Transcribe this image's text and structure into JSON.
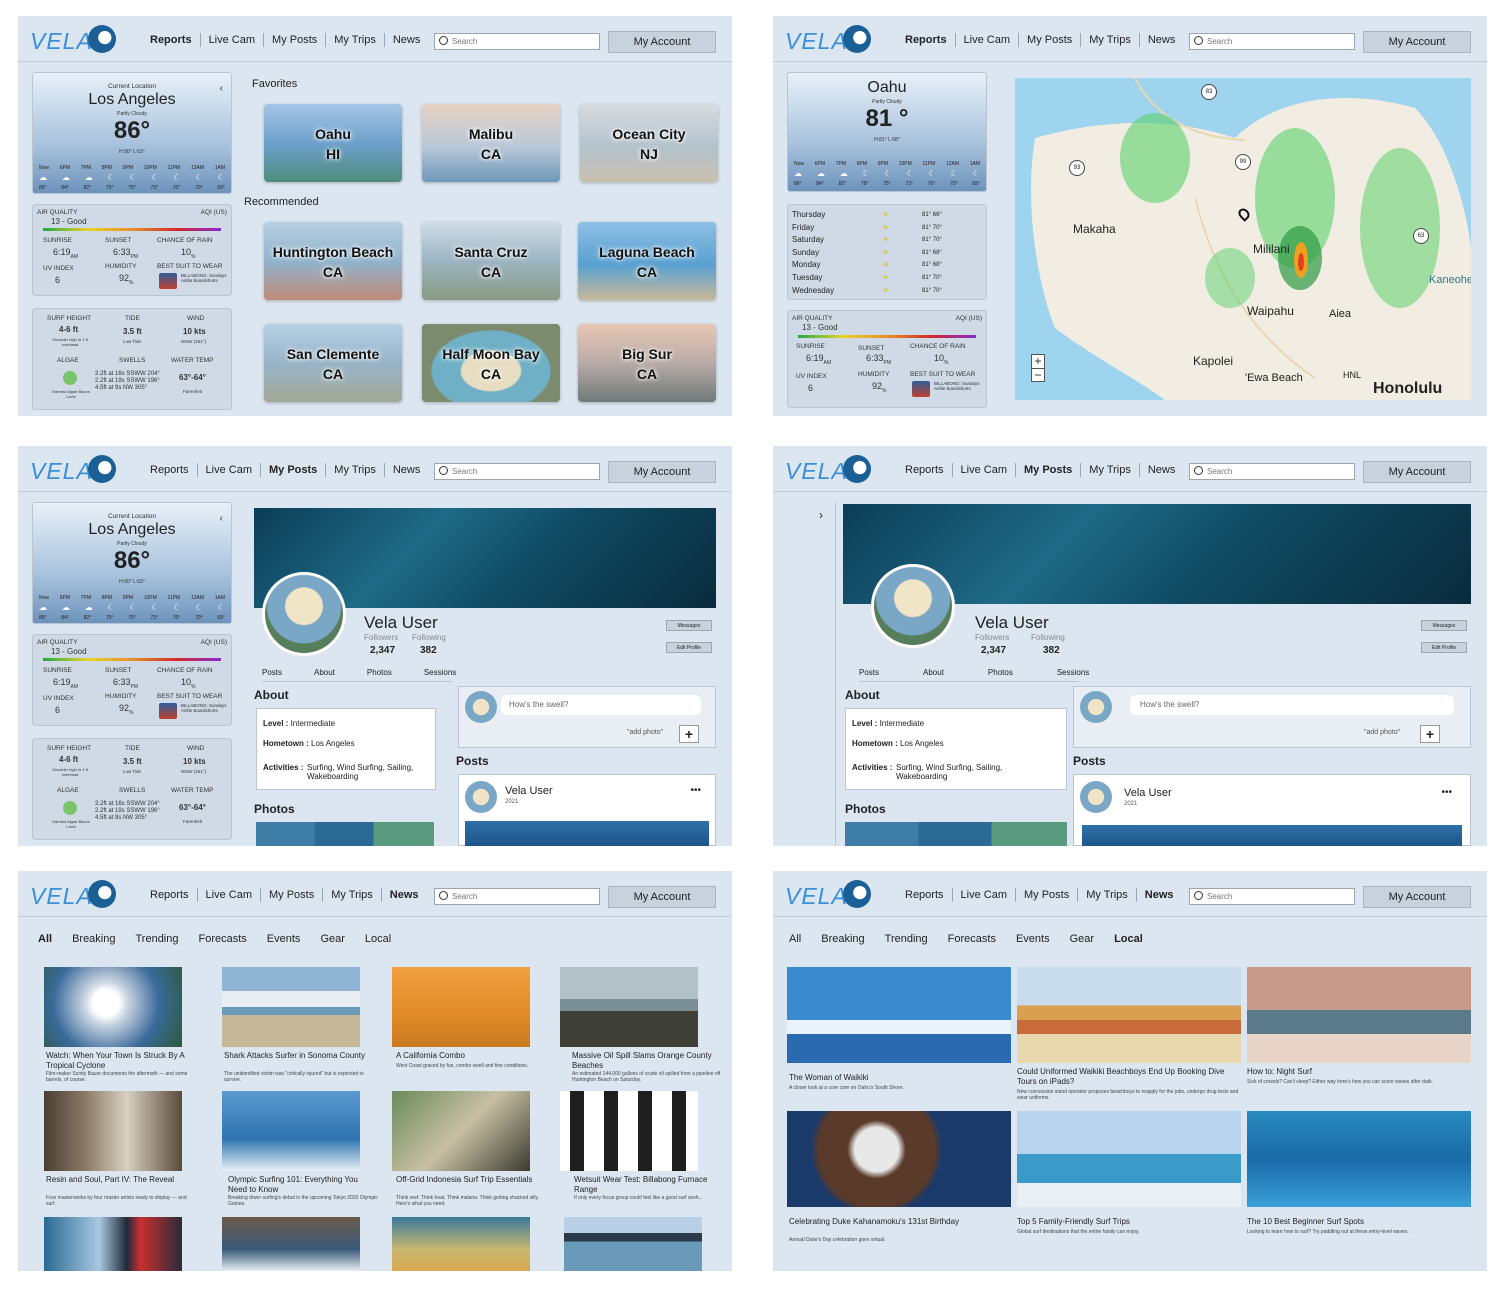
{
  "nav": {
    "logo": "VELA",
    "links": [
      "Reports",
      "Live Cam",
      "My Posts",
      "My Trips",
      "News"
    ],
    "search_placeholder": "Search",
    "account": "My Account"
  },
  "weather_la": {
    "current_label": "Current Location",
    "city": "Los Angeles",
    "condition": "Partly Cloudy",
    "temp": "86°",
    "hilo": "H:90° L:63°",
    "hours": [
      "Now",
      "6PM",
      "7PM",
      "8PM",
      "9PM",
      "10PM",
      "11PM",
      "12AM",
      "1AM"
    ],
    "hour_temps": [
      "86°",
      "84°",
      "82°",
      "79°",
      "75°",
      "73°",
      "70°",
      "70°",
      "69°"
    ]
  },
  "weather_oahu": {
    "city": "Oahu",
    "condition": "Partly Cloudy",
    "temp": "81 °",
    "hilo": "H:81° L:68°",
    "hours": [
      "Now",
      "6PM",
      "7PM",
      "8PM",
      "9PM",
      "10PM",
      "11PM",
      "12AM",
      "1AM"
    ],
    "hour_temps": [
      "86°",
      "84°",
      "82°",
      "79°",
      "75°",
      "73°",
      "70°",
      "70°",
      "69°"
    ],
    "days": [
      {
        "d": "Thursday",
        "r": "81°   66°"
      },
      {
        "d": "Friday",
        "r": "81°   70°"
      },
      {
        "d": "Saturday",
        "r": "81°   70°"
      },
      {
        "d": "Sunday",
        "r": "81°   68°"
      },
      {
        "d": "Monday",
        "r": "81°   68°"
      },
      {
        "d": "Tuesday",
        "r": "81°   70°"
      },
      {
        "d": "Wednesday",
        "r": "81°   70°"
      }
    ]
  },
  "aq": {
    "label": "AIR QUALITY",
    "unit": "AQI (US)",
    "value": "13 - Good",
    "sunrise_lbl": "SUNRISE",
    "sunrise": "6:19",
    "am": "AM",
    "sunset_lbl": "SUNSET",
    "sunset": "6:33",
    "pm": "PM",
    "rain_lbl": "CHANCE OF RAIN",
    "rain": "10",
    "pct": "%",
    "uv_lbl": "UV INDEX",
    "uv": "6",
    "hum_lbl": "HUMIDITY",
    "hum": "92",
    "suit_lbl": "BEST SUIT TO WEAR",
    "suit": "BILLABONG: Sundays Airlite Boardshorts"
  },
  "aq_oahu": {
    "uv": "6"
  },
  "surf": {
    "height_lbl": "SURF HEIGHT",
    "height": "4-6 ft",
    "height_note": "Shoulder high to 1 ft overhead",
    "tide_lbl": "TIDE",
    "tide": "3.5 ft",
    "tide_note": "Low Tide",
    "wind_lbl": "WIND",
    "wind": "10 kts",
    "wind_note": "WSW (251°)",
    "algae_lbl": "ALGAE",
    "algae_note": "Harmful Algae Bloom Level",
    "swells_lbl": "SWELLS",
    "swells": [
      "3.2ft at 16s SSWW 204°",
      "2.2ft at 19s SSWW 196°",
      "4.5ft at 9s NW 305°"
    ],
    "water_lbl": "WATER TEMP",
    "water": "63°-64°",
    "water_note": "Farenheit"
  },
  "favorites": {
    "label": "Favorites",
    "items": [
      {
        "t": "Oahu",
        "s": "HI"
      },
      {
        "t": "Malibu",
        "s": "CA"
      },
      {
        "t": "Ocean City",
        "s": "NJ"
      }
    ]
  },
  "recommended": {
    "label": "Recommended",
    "items": [
      {
        "t": "Huntington Beach",
        "s": "CA"
      },
      {
        "t": "Santa Cruz",
        "s": "CA"
      },
      {
        "t": "Laguna Beach",
        "s": "CA"
      },
      {
        "t": "San Clemente",
        "s": "CA"
      },
      {
        "t": "Half Moon Bay",
        "s": "CA"
      },
      {
        "t": "Big Sur",
        "s": "CA"
      }
    ]
  },
  "map": {
    "places": [
      "Makaha",
      "Mililani",
      "Waipahu",
      "Aiea",
      "Kapolei",
      "'Ewa Beach",
      "HNL",
      "Honolulu",
      "Kaneohe"
    ],
    "routes": [
      "83",
      "99",
      "93",
      "63"
    ],
    "zoom_in": "+",
    "zoom_out": "−"
  },
  "profile": {
    "name": "Vela User",
    "followers_lbl": "Followers",
    "followers": "2,347",
    "following_lbl": "Following",
    "following": "382",
    "messages": "Messages",
    "edit": "Edit Profile",
    "tabs": [
      "Posts",
      "About",
      "Photos",
      "Sessions"
    ],
    "about_title": "About",
    "level_lbl": "Level :",
    "level": "Intermediate",
    "home_lbl": "Hometown :",
    "home": "Los Angeles",
    "act_lbl": "Activities :",
    "act": "Surfing, Wind Surfing, Sailing, Wakeboarding",
    "photos_title": "Photos",
    "prompt": "How's the swell?",
    "add_photo": "\"add photo\"",
    "plus": "+",
    "posts_title": "Posts",
    "post_user": "Vela User",
    "post_year": "2021",
    "more": "•••",
    "expand": "›",
    "collapse": "‹"
  },
  "news": {
    "tabs": [
      "All",
      "Breaking",
      "Trending",
      "Forecasts",
      "Events",
      "Gear",
      "Local"
    ],
    "items": [
      {
        "t": "Watch: When Your Town Is Struck By A Tropical Cyclone",
        "d": "Film-maker Scotty Bauer documents the aftermath — and some barrels, of course."
      },
      {
        "t": "Shark Attacks Surfer in Sonoma County",
        "d": "The unidentified victim was \"critically injured\" but is expected to survive."
      },
      {
        "t": "A California Combo",
        "d": "West Coast graced by fun, combo swell and fine conditions."
      },
      {
        "t": "Massive Oil Spill Slams Orange County Beaches",
        "d": "An estimated 144,000 gallons of crude oil spilled from a pipeline off Huntington Beach on Saturday."
      },
      {
        "t": "Resin and Soul, Part IV: The Reveal",
        "d": "Four masterworks by four master artists ready to display — and surf."
      },
      {
        "t": "Olympic Surfing 101: Everything You Need to Know",
        "d": "Breaking down surfing's debut in the upcoming Tokyo 2020 Olympic Games."
      },
      {
        "t": "Off-Grid Indonesia Surf Trip Essentials",
        "d": "Think reef. Think heat. Think malaria. Think getting shacked silly. Here's what you need."
      },
      {
        "t": "Wetsuit Wear Test: Billabong Furnace Range",
        "d": "If only every focus group could feel like a good surf sesh..."
      }
    ]
  },
  "local": {
    "items": [
      {
        "t": "The Woman of Waikiki",
        "d": "A closer look at a core core on Oahu's South Shore."
      },
      {
        "t": "Could Uniformed Waikiki Beachboys End Up Booking Dive Tours on iPads?",
        "d": "New concession stand operator proposes beachboys to reapply for the jobs, undergo drug tests and wear uniforms."
      },
      {
        "t": "How to: Night Surf",
        "d": "Sick of crowds? Can't sleep? Either way here's how you can score waves after dark."
      },
      {
        "t": "Celebrating Duke Kahanamoku's 131st Birthday",
        "d": "Annual Duke's Day celebration goes virtual."
      },
      {
        "t": "Top 5 Family-Friendly Surf Trips",
        "d": "Global surf destinations that the entire family can enjoy."
      },
      {
        "t": "The 10 Best Beginner Surf Spots",
        "d": "Looking to learn how to surf? Try paddling out at these entry-level waves."
      }
    ]
  },
  "colors": {
    "accent": "#3a8fd8",
    "panel": "#dce6f0"
  }
}
